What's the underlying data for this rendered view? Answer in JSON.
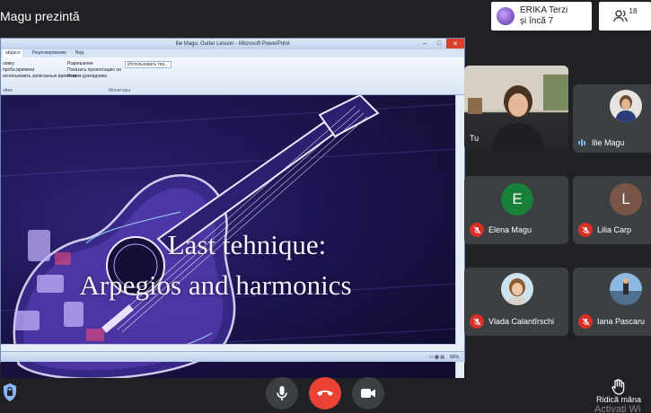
{
  "header": {
    "presenter_title": "Magu prezintă",
    "notification": {
      "line1": "ERIKA Terzi",
      "line2": "și încă 7"
    },
    "people_count": "18"
  },
  "presentation": {
    "window_title": "Ilie Magu. Guitar Lesson - Microsoft PowerPoint",
    "tabs": [
      "айдася",
      "Рецензирование",
      "Вид"
    ],
    "ribbon": {
      "col1": [
        "новку",
        "проба времени",
        "использовать записанные времена"
      ],
      "col2": [
        "Разрешение",
        "Показать презентацию на",
        "Режим докладчика"
      ],
      "select": "Использовать тек...",
      "group1": "ойка",
      "group2": "Мониторы"
    },
    "slide_line1": "Last tehnique:",
    "slide_line2": "Arpegios and harmonics",
    "zoom": "66%"
  },
  "participants": [
    {
      "name": "Tu",
      "kind": "video",
      "muted": false
    },
    {
      "name": "Ilie Magu",
      "kind": "photo",
      "muted": false,
      "speaking": true
    },
    {
      "name": "Elena Magu",
      "kind": "letter",
      "letter": "E",
      "color": "#188038",
      "muted": true
    },
    {
      "name": "Lilia Carp",
      "kind": "letter",
      "letter": "L",
      "color": "#795548",
      "muted": true
    },
    {
      "name": "Vlada Calantîrschi",
      "kind": "photo",
      "muted": true
    },
    {
      "name": "Iana Pascaru",
      "kind": "photo",
      "muted": true
    }
  ],
  "controls": {
    "raise_hand_label": "Ridică mâna",
    "watermark": "Activați Wi"
  },
  "colors": {
    "accent_red": "#ea4335",
    "background": "#202124",
    "tile": "#3c4043"
  }
}
